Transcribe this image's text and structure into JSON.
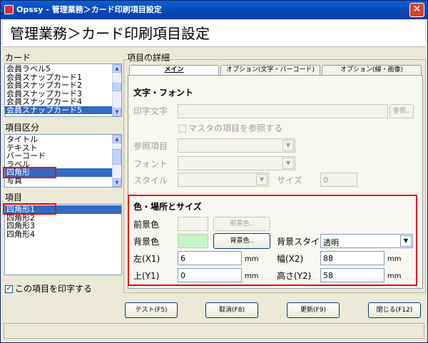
{
  "window": {
    "title": "Opssy - 管理業務＞カード印刷項目設定",
    "close_glyph": "✕"
  },
  "page_title": "管理業務＞カード印刷項目設定",
  "card": {
    "label": "カード",
    "items": [
      "会員ラベル5",
      "会員スナップカード1",
      "会員スナップカード2",
      "会員スナップカード3",
      "会員スナップカード4",
      "会員スナップカード5"
    ],
    "selected": 5
  },
  "item_category": {
    "label": "項目区分",
    "items": [
      "タイトル",
      "テキスト",
      "バーコード",
      "ラベル",
      "四角形",
      "写真"
    ],
    "selected": 4
  },
  "items_list": {
    "label": "項目",
    "items": [
      "四角形1",
      "四角形2",
      "四角形3",
      "四角形4"
    ],
    "selected": 0
  },
  "print_item_checkbox": {
    "label": "この項目を印字する",
    "checked": true,
    "mark": "✓"
  },
  "details": {
    "label": "項目の詳細",
    "tabs": [
      "メイン",
      "オプション(文字・バーコード)",
      "オプション(線・画像)"
    ],
    "active_tab": 0
  },
  "text_font": {
    "title": "文字・フォント",
    "print_text_label": "印字文字",
    "ref_button": "参照..",
    "master_ref_label": "マスタの項目を参照する",
    "ref_item_label": "参照項目",
    "font_label": "フォント",
    "style_label": "スタイル",
    "size_label": "サイズ",
    "size_value": "0"
  },
  "color_place": {
    "title": "色・場所とサイズ",
    "fg_label": "前景色",
    "fg_button": "前景色..",
    "bg_label": "背景色",
    "bg_button": "背景色..",
    "bg_color": "#c6f5c6",
    "bg_style_label": "背景スタイル",
    "bg_style_value": "透明",
    "left_label": "左(X1)",
    "left_value": "6",
    "width_label": "幅(X2)",
    "width_value": "88",
    "top_label": "上(Y1)",
    "top_value": "0",
    "height_label": "高さ(Y2)",
    "height_value": "58",
    "unit": "mm"
  },
  "buttons": {
    "test": "テスト(F5)",
    "cancel": "取消(F8)",
    "update": "更新(F9)",
    "close": "閉じる(F12)"
  },
  "icons": {
    "dropdown": "▼",
    "up": "▲",
    "down": "▼"
  }
}
